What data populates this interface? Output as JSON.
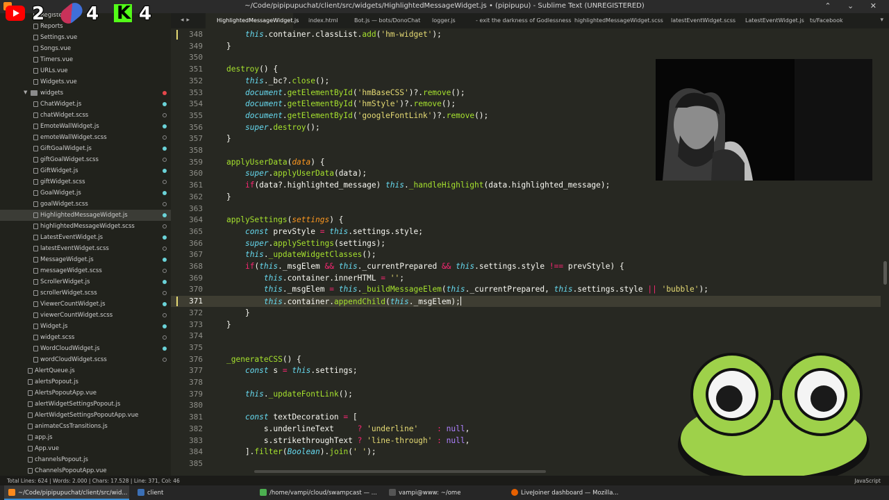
{
  "window": {
    "title": "~/Code/pipipupuchat/client/src/widgets/HighlightedMessageWidget.js • (pipipupu) - Sublime Text (UNREGISTERED)",
    "controls": "⌃ ⌄ ✕"
  },
  "overlay": {
    "youtube_count": "2",
    "pill_count": "4",
    "kick_count": "4"
  },
  "tabs": [
    "HighlightedMessageWidget.js",
    "index.html",
    "Bot.js — bots/DonoChat",
    "logger.js",
    "- exit the darkness of Godlessness",
    "highlightedMessageWidget.scss",
    "latestEventWidget.scss",
    "LatestEventWidget.js",
    "ts/Facebook"
  ],
  "sidebar": {
    "items": [
      {
        "label": "Register",
        "indent": 58,
        "dot": ""
      },
      {
        "label": "Reports",
        "indent": 58,
        "dot": ""
      },
      {
        "label": "Settings.vue",
        "indent": 58,
        "dot": ""
      },
      {
        "label": "Songs.vue",
        "indent": 58,
        "dot": ""
      },
      {
        "label": "Timers.vue",
        "indent": 58,
        "dot": ""
      },
      {
        "label": "URLs.vue",
        "indent": 58,
        "dot": ""
      },
      {
        "label": "Widgets.vue",
        "indent": 58,
        "dot": ""
      },
      {
        "label": "widgets",
        "indent": 58,
        "dot": "red",
        "folder": true
      },
      {
        "label": "ChatWidget.js",
        "indent": 58,
        "dot": "filled"
      },
      {
        "label": "chatWidget.scss",
        "indent": 58,
        "dot": "hollow"
      },
      {
        "label": "EmoteWallWidget.js",
        "indent": 58,
        "dot": "filled"
      },
      {
        "label": "emoteWallWidget.scss",
        "indent": 58,
        "dot": "hollow"
      },
      {
        "label": "GiftGoalWidget.js",
        "indent": 58,
        "dot": "filled"
      },
      {
        "label": "giftGoalWidget.scss",
        "indent": 58,
        "dot": "hollow"
      },
      {
        "label": "GiftWidget.js",
        "indent": 58,
        "dot": "filled"
      },
      {
        "label": "giftWidget.scss",
        "indent": 58,
        "dot": "hollow"
      },
      {
        "label": "GoalWidget.js",
        "indent": 58,
        "dot": "filled"
      },
      {
        "label": "goalWidget.scss",
        "indent": 58,
        "dot": "hollow"
      },
      {
        "label": "HighlightedMessageWidget.js",
        "indent": 58,
        "dot": "filled",
        "selected": true
      },
      {
        "label": "highlightedMessageWidget.scss",
        "indent": 58,
        "dot": "hollow"
      },
      {
        "label": "LatestEventWidget.js",
        "indent": 58,
        "dot": "filled"
      },
      {
        "label": "latestEventWidget.scss",
        "indent": 58,
        "dot": "hollow"
      },
      {
        "label": "MessageWidget.js",
        "indent": 58,
        "dot": "filled"
      },
      {
        "label": "messageWidget.scss",
        "indent": 58,
        "dot": "hollow"
      },
      {
        "label": "ScrollerWidget.js",
        "indent": 58,
        "dot": "filled"
      },
      {
        "label": "scrollerWidget.scss",
        "indent": 58,
        "dot": "hollow"
      },
      {
        "label": "ViewerCountWidget.js",
        "indent": 58,
        "dot": "filled"
      },
      {
        "label": "viewerCountWidget.scss",
        "indent": 58,
        "dot": "hollow"
      },
      {
        "label": "Widget.js",
        "indent": 58,
        "dot": "filled"
      },
      {
        "label": "widget.scss",
        "indent": 58,
        "dot": "hollow"
      },
      {
        "label": "WordCloudWidget.js",
        "indent": 58,
        "dot": "filled"
      },
      {
        "label": "wordCloudWidget.scss",
        "indent": 58,
        "dot": "hollow"
      },
      {
        "label": "AlertQueue.js",
        "indent": 50,
        "dot": ""
      },
      {
        "label": "alertsPopout.js",
        "indent": 50,
        "dot": ""
      },
      {
        "label": "AlertsPopoutApp.vue",
        "indent": 50,
        "dot": ""
      },
      {
        "label": "alertWidgetSettingsPopout.js",
        "indent": 50,
        "dot": ""
      },
      {
        "label": "AlertWidgetSettingsPopoutApp.vue",
        "indent": 50,
        "dot": ""
      },
      {
        "label": "animateCssTransitions.js",
        "indent": 50,
        "dot": ""
      },
      {
        "label": "app.js",
        "indent": 50,
        "dot": ""
      },
      {
        "label": "App.vue",
        "indent": 50,
        "dot": ""
      },
      {
        "label": "channelsPopout.js",
        "indent": 50,
        "dot": ""
      },
      {
        "label": "ChannelsPopoutApp.vue",
        "indent": 50,
        "dot": ""
      }
    ]
  },
  "editor": {
    "current_line": "371",
    "lines": [
      {
        "n": "348",
        "html": "    <span class='kw'>this</span>.container.classList.<span class='fn'>add</span>(<span class='str'>'hm-widget'</span>);"
      },
      {
        "n": "349",
        "html": "}"
      },
      {
        "n": "350",
        "html": ""
      },
      {
        "n": "351",
        "html": "<span class='fn'>destroy</span>() {"
      },
      {
        "n": "352",
        "html": "    <span class='kw'>this</span>._bc?.<span class='fn'>close</span>();"
      },
      {
        "n": "353",
        "html": "    <span class='type'>document</span>.<span class='fn'>getElementById</span>(<span class='str'>'hmBaseCSS'</span>)?.<span class='fn'>remove</span>();"
      },
      {
        "n": "354",
        "html": "    <span class='type'>document</span>.<span class='fn'>getElementById</span>(<span class='str'>'hmStyle'</span>)?.<span class='fn'>remove</span>();"
      },
      {
        "n": "355",
        "html": "    <span class='type'>document</span>.<span class='fn'>getElementById</span>(<span class='str'>'googleFontLink'</span>)?.<span class='fn'>remove</span>();"
      },
      {
        "n": "356",
        "html": "    <span class='kw'>super</span>.<span class='fn'>destroy</span>();"
      },
      {
        "n": "357",
        "html": "}"
      },
      {
        "n": "358",
        "html": ""
      },
      {
        "n": "359",
        "html": "<span class='fn'>applyUserData</span>(<span class='param'>data</span>) {"
      },
      {
        "n": "360",
        "html": "    <span class='kw'>super</span>.<span class='fn'>applyUserData</span>(data);"
      },
      {
        "n": "361",
        "html": "    <span class='st'>if</span>(data?.highlighted_message) <span class='kw'>this</span>.<span class='fn'>_handleHighlight</span>(data.highlighted_message);"
      },
      {
        "n": "362",
        "html": "}"
      },
      {
        "n": "363",
        "html": ""
      },
      {
        "n": "364",
        "html": "<span class='fn'>applySettings</span>(<span class='param'>settings</span>) {"
      },
      {
        "n": "365",
        "html": "    <span class='kw'>const</span> prevStyle <span class='op'>=</span> <span class='kw'>this</span>.settings.style;"
      },
      {
        "n": "366",
        "html": "    <span class='kw'>super</span>.<span class='fn'>applySettings</span>(settings);"
      },
      {
        "n": "367",
        "html": "    <span class='kw'>this</span>.<span class='fn'>_updateWidgetClasses</span>();"
      },
      {
        "n": "368",
        "html": "    <span class='st'>if</span>(<span class='kw'>this</span>._msgElem <span class='op'>&amp;&amp;</span> <span class='kw'>this</span>._currentPrepared <span class='op'>&amp;&amp;</span> <span class='kw'>this</span>.settings.style <span class='op'>!==</span> prevStyle) {"
      },
      {
        "n": "369",
        "html": "        <span class='kw'>this</span>.container.innerHTML <span class='op'>=</span> <span class='str'>''</span>;"
      },
      {
        "n": "370",
        "html": "        <span class='kw'>this</span>._msgElem <span class='op'>=</span> <span class='kw'>this</span>.<span class='fn'>_buildMessageElem</span>(<span class='kw'>this</span>._currentPrepared, <span class='kw'>this</span>.settings.style <span class='op'>||</span> <span class='str'>'bubble'</span>);"
      },
      {
        "n": "371",
        "html": "        <span class='kw'>this</span>.container.<span class='fn'>appendChild</span>(<span class='kw'>this</span>._msgElem);<span class='cursor'></span>"
      },
      {
        "n": "372",
        "html": "    }"
      },
      {
        "n": "373",
        "html": "}"
      },
      {
        "n": "374",
        "html": ""
      },
      {
        "n": "375",
        "html": ""
      },
      {
        "n": "376",
        "html": "<span class='fn'>_generateCSS</span>() {"
      },
      {
        "n": "377",
        "html": "    <span class='kw'>const</span> s <span class='op'>=</span> <span class='kw'>this</span>.settings;"
      },
      {
        "n": "378",
        "html": ""
      },
      {
        "n": "379",
        "html": "    <span class='kw'>this</span>.<span class='fn'>_updateFontLink</span>();"
      },
      {
        "n": "380",
        "html": ""
      },
      {
        "n": "381",
        "html": "    <span class='kw'>const</span> textDecoration <span class='op'>=</span> ["
      },
      {
        "n": "382",
        "html": "        s.underlineText     <span class='op'>?</span> <span class='str'>'underline'</span>    <span class='op'>:</span> <span class='const'>null</span>,"
      },
      {
        "n": "383",
        "html": "        s.strikethroughText <span class='op'>?</span> <span class='str'>'line-through'</span> <span class='op'>:</span> <span class='const'>null</span>,"
      },
      {
        "n": "384",
        "html": "    ].<span class='fn'>filter</span>(<span class='type'>Boolean</span>).<span class='fn'>join</span>(<span class='str'>' '</span>);"
      },
      {
        "n": "385",
        "html": ""
      }
    ]
  },
  "status": {
    "left": "Total Lines: 624 | Words: 2.000 | Chars: 17.528 | Line: 371, Col: 46",
    "syntax": "JavaScript"
  },
  "taskbar": [
    {
      "label": "~/Code/pipipupuchat/client/src/wid...",
      "color": "#ff8a1c",
      "active": true
    },
    {
      "label": "client",
      "color": "#3b6fb5"
    },
    {
      "label": "/home/vampi/cloud/swampcast — ...",
      "color": "#4caf50"
    },
    {
      "label": "vampi@www: ~/ome",
      "color": "#555555"
    },
    {
      "label": "LiveJoiner dashboard — Mozilla...",
      "color": "#e66000"
    }
  ],
  "colors": {
    "background": "#272822",
    "keyword": "#66d9ef",
    "string": "#e6db74",
    "function": "#a6e22e",
    "operator": "#f92672"
  }
}
